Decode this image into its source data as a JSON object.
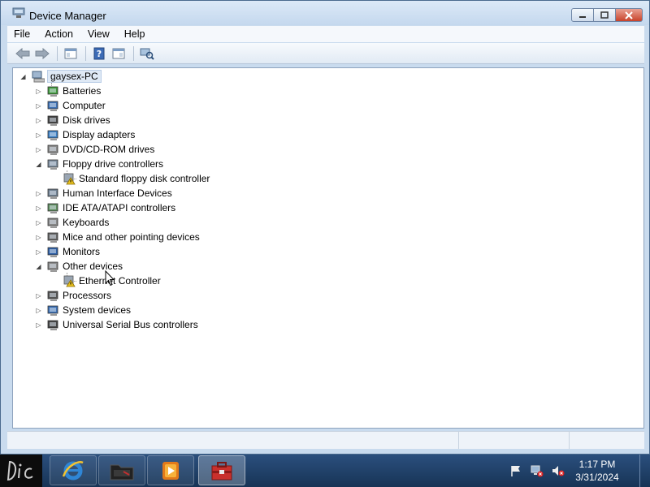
{
  "window": {
    "title": "Device Manager",
    "icon": "device-manager-icon"
  },
  "menu": [
    "File",
    "Action",
    "View",
    "Help"
  ],
  "toolbar": {
    "buttons": [
      "back-arrow-icon",
      "forward-arrow-icon",
      "show-hide-console-tree-icon",
      "help-icon",
      "properties-icon",
      "scan-hardware-icon"
    ]
  },
  "tree": {
    "root": "gaysex-PC",
    "categories": [
      {
        "label": "Batteries",
        "icon": "battery-icon",
        "expanded": false,
        "children": []
      },
      {
        "label": "Computer",
        "icon": "computer-icon",
        "expanded": false,
        "children": []
      },
      {
        "label": "Disk drives",
        "icon": "disk-drive-icon",
        "expanded": false,
        "children": []
      },
      {
        "label": "Display adapters",
        "icon": "display-adapter-icon",
        "expanded": false,
        "children": []
      },
      {
        "label": "DVD/CD-ROM drives",
        "icon": "dvd-drive-icon",
        "expanded": false,
        "children": []
      },
      {
        "label": "Floppy drive controllers",
        "icon": "floppy-controller-icon",
        "expanded": true,
        "children": [
          "Standard floppy disk controller"
        ]
      },
      {
        "label": "Human Interface Devices",
        "icon": "hid-icon",
        "expanded": false,
        "children": []
      },
      {
        "label": "IDE ATA/ATAPI controllers",
        "icon": "ide-controller-icon",
        "expanded": false,
        "children": []
      },
      {
        "label": "Keyboards",
        "icon": "keyboard-icon",
        "expanded": false,
        "children": []
      },
      {
        "label": "Mice and other pointing devices",
        "icon": "mouse-icon",
        "expanded": false,
        "children": []
      },
      {
        "label": "Monitors",
        "icon": "monitor-icon",
        "expanded": false,
        "children": []
      },
      {
        "label": "Other devices",
        "icon": "unknown-device-icon",
        "expanded": true,
        "children": [
          "Ethernet Controller"
        ]
      },
      {
        "label": "Processors",
        "icon": "processor-icon",
        "expanded": false,
        "children": []
      },
      {
        "label": "System devices",
        "icon": "system-device-icon",
        "expanded": false,
        "children": []
      },
      {
        "label": "Universal Serial Bus controllers",
        "icon": "usb-icon",
        "expanded": false,
        "children": []
      }
    ]
  },
  "taskbar": {
    "items": [
      "ie-icon",
      "folder-icon",
      "media-player-icon",
      "device-manager-icon"
    ],
    "clock_time": "1:17 PM",
    "clock_date": "3/31/2024"
  },
  "colors": {
    "window_frame": "#c9dbee",
    "taskbar": "#1e3d63",
    "warning": "#e8c120"
  }
}
